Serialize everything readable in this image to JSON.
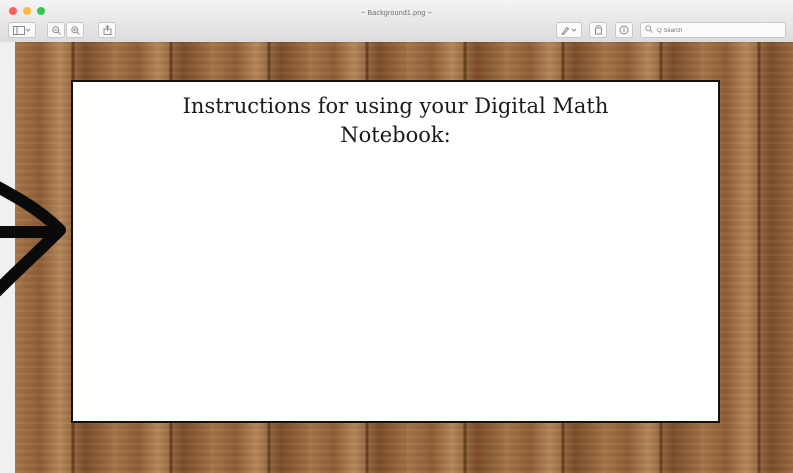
{
  "window": {
    "title": "~ Background1.png ~"
  },
  "toolbar": {
    "left_buttons": [
      "sidebar-toggle",
      "zoom-out",
      "zoom-in",
      "share"
    ],
    "right_buttons": [
      "markup",
      "rotate",
      "info"
    ],
    "search_placeholder": "Q Search"
  },
  "card": {
    "title": "Instructions for using your Digital Math Notebook:"
  },
  "colors": {
    "wood_dark": "#7b4d2a",
    "wood_light": "#b58759",
    "card_border": "#111111"
  }
}
